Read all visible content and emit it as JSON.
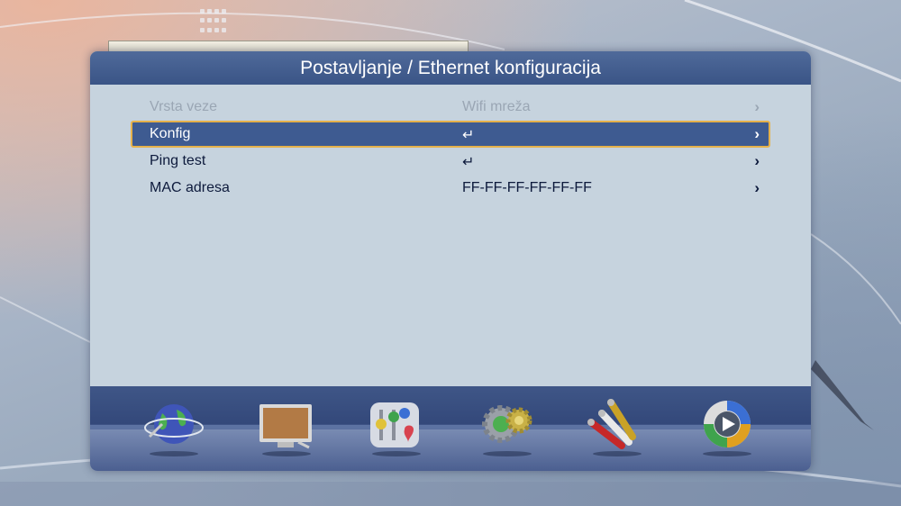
{
  "header": {
    "title": "Postavljanje / Ethernet konfiguracija"
  },
  "menu": {
    "items": [
      {
        "label": "Vrsta veze",
        "value": "Wifi mreža",
        "arrow": "›",
        "state": "disabled"
      },
      {
        "label": "Konfig",
        "value": "↵",
        "arrow": "›",
        "state": "selected"
      },
      {
        "label": "Ping test",
        "value": "↵",
        "arrow": "›",
        "state": "normal"
      },
      {
        "label": "MAC adresa",
        "value": "FF-FF-FF-FF-FF-FF",
        "arrow": "›",
        "state": "normal"
      }
    ]
  },
  "icon_bar": {
    "icons": [
      "globe-network-icon",
      "tv-display-icon",
      "settings-sliders-icon",
      "gears-icon",
      "av-cables-icon",
      "media-play-icon"
    ]
  },
  "colors": {
    "header_bg": "#3a5486",
    "panel_bg": "#c6d3de",
    "selected_bg": "#3e5b91",
    "selected_border": "#e5b14b",
    "text": "#0d1a3c",
    "disabled_text": "#9aa6b4"
  }
}
